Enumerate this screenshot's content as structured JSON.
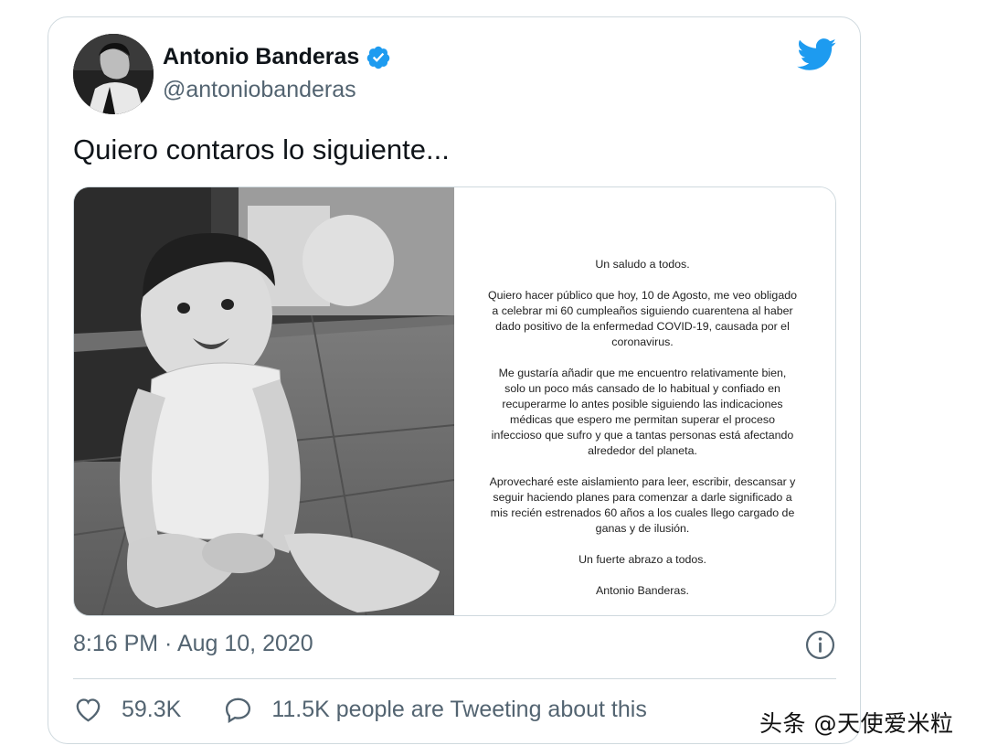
{
  "author": {
    "display_name": "Antonio Banderas",
    "handle": "@antoniobanderas"
  },
  "tweet": {
    "text": "Quiero contaros lo siguiente...",
    "timestamp": "8:16 PM · Aug 10, 2020"
  },
  "letter": {
    "greeting": "Un saludo a todos.",
    "paragraph_1": "Quiero hacer público que hoy, 10 de Agosto, me veo obligado a celebrar mi 60 cumpleaños siguiendo cuarentena al haber dado positivo de la enfermedad COVID-19, causada por el coronavirus.",
    "paragraph_2": "Me gustaría añadir que me encuentro relativamente bien, solo un poco más cansado de lo habitual y confiado en recuperarme lo antes posible siguiendo las indicaciones médicas que espero me permitan superar el proceso infeccioso que sufro y que a tantas personas está afectando alrededor del planeta.",
    "paragraph_3": "Aprovecharé este aislamiento para leer, escribir, descansar y seguir haciendo planes para comenzar a darle significado a mis recién estrenados 60 años a los cuales llego cargado de ganas y de ilusión.",
    "closing": "Un fuerte abrazo a todos.",
    "signature": "Antonio Banderas."
  },
  "actions": {
    "likes": "59.3K",
    "replies": "11.5K people are Tweeting about this"
  },
  "watermark": "头条 @天使爱米粒",
  "icons": {
    "verified": "verified-badge-icon",
    "bird": "twitter-bird-icon",
    "info": "info-icon",
    "like": "heart-icon",
    "reply": "speech-bubble-icon"
  },
  "colors": {
    "twitter_blue": "#1d9bf0",
    "secondary_text": "#536471",
    "border": "#cfd9de"
  }
}
